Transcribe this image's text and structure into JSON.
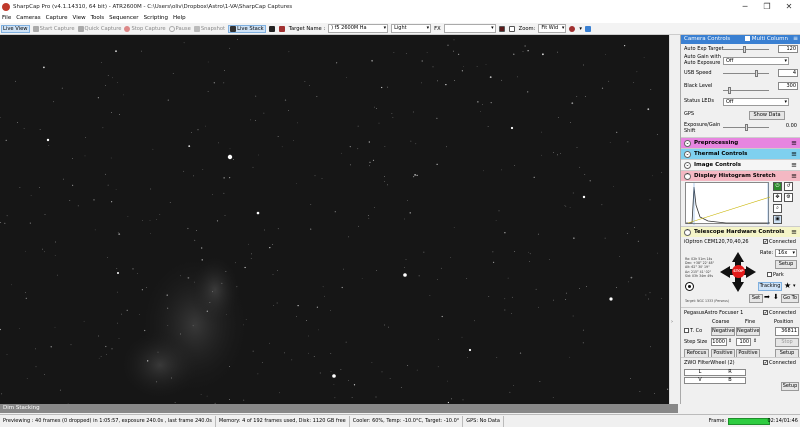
{
  "window": {
    "title": "SharpCap Pro (v4.1.14310, 64 bit) - ATR2600M - C:\\Users\\oliv\\Dropbox\\Astro\\1-VA\\SharpCap Captures",
    "minimize": "─",
    "maximize": "❐",
    "close": "✕"
  },
  "menu": [
    "File",
    "Cameras",
    "Capture",
    "View",
    "Tools",
    "Sequencer",
    "Scripting",
    "Help"
  ],
  "toolbar": {
    "live_view": "Live View",
    "start_capture": "Start Capture",
    "quick_capture": "Quick Capture",
    "stop_capture": "Stop Capture",
    "pause": "Pause",
    "snapshot": "Snapshot",
    "live_stack": "Live Stack",
    "target_label": "Target Name :",
    "target_value": ") f5 2600M Ha",
    "color_value": "Light",
    "fx_label": "FX",
    "zoom_label": "Zoom:",
    "zoom_value": "Fit Wid"
  },
  "viewport": {
    "bottom_tab": "Dim Stacking"
  },
  "status": {
    "preview": "Previewing : 40 frames (0 dropped) in 1:05:57, exposure 240.0s , last frame 240.0s",
    "memory": "Memory: 4 of 192 frames used, Disk: 1120 GB free",
    "cooler": "Cooler: 60%, Temp: -10.0°C, Target: -10.0°",
    "gps": "GPS: No Data",
    "frame_label": "Frame:",
    "clock": "02:14/01:46"
  },
  "panel": {
    "header": {
      "title": "Camera Controls",
      "multi_column": "Multi Column"
    },
    "auto_exp_target": {
      "label": "Auto Exp Target",
      "value": "120"
    },
    "auto_gain": {
      "label": "Auto Gain with Auto Exposure",
      "value": "Off"
    },
    "usb_speed": {
      "label": "USB Speed",
      "value": "4"
    },
    "black_level": {
      "label": "Black Level",
      "value": "300"
    },
    "status_leds": {
      "label": "Status LEDs",
      "value": "Off"
    },
    "gps": {
      "label": "GPS",
      "button": "Show Data"
    },
    "exposure_gain_shift": {
      "label": "Exposure/Gain Shift",
      "value": "0.00"
    },
    "sections": {
      "preprocessing": "Preprocessing",
      "thermal": "Thermal Controls",
      "image_controls": "Image Controls",
      "histogram": "Display Histogram Stretch",
      "telescope": "Telescope Hardware Controls"
    },
    "telescope": {
      "mount": "iOptron CEM120,70,40,26",
      "connected": "Connected",
      "rate_label": "Rate:",
      "rate_value": "16x",
      "setup": "Setup",
      "park": "Park",
      "tracking": "Tracking",
      "stop": "STOP",
      "set": "Set",
      "goto": "Go To",
      "info": [
        "Ra:  02h 51m 14s",
        "Dec: +38° 22' 48\"",
        "Alt: 62° 30' 19\"",
        "Az:  215° 41' 02\"",
        "Sid: 03h 34m 49s"
      ],
      "target_line": "Target: NGC 1333 (Perseus)"
    },
    "focuser": {
      "name": "PegasusAstro Focuser 1",
      "connected": "Connected",
      "coarse": "Coarse",
      "fine": "Fine",
      "position": "Position",
      "temp_comp": "T. Co",
      "negative": "Negative",
      "position_value": "36811",
      "step_size_label": "Step Size",
      "step_size_value": "1000",
      "fine_step": "100",
      "stop": "Stop",
      "refocus": "Refocus",
      "positive": "Positive",
      "setup": "Setup"
    },
    "filter_wheel": {
      "name": "ZWO FilterWheel (2)",
      "connected": "Connected",
      "row1": [
        "L",
        "R"
      ],
      "row2": [
        "V",
        "B"
      ],
      "setup": "Setup"
    }
  }
}
